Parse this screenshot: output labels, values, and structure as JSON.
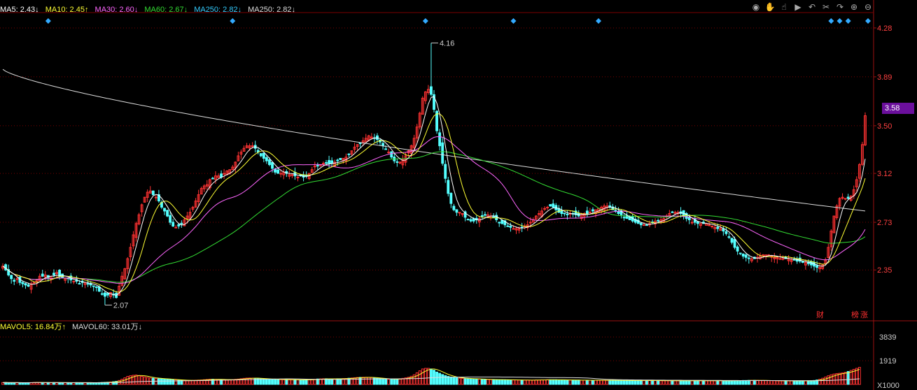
{
  "legend_price": [
    {
      "label": "MA5: ",
      "value": "2.43",
      "arrow": "↓",
      "color": "#ffffff"
    },
    {
      "label": "MA10: ",
      "value": "2.45",
      "arrow": "↑",
      "color": "#ffff33"
    },
    {
      "label": "MA30: ",
      "value": "2.60",
      "arrow": "↓",
      "color": "#ff66ff"
    },
    {
      "label": "MA60: ",
      "value": "2.67",
      "arrow": "↓",
      "color": "#33dd33"
    },
    {
      "label": "MA250: ",
      "value": "2.82",
      "arrow": "↓",
      "color": "#33ccff"
    },
    {
      "label": "MA250: ",
      "value": "2.82",
      "arrow": "↓",
      "color": "#dddddd"
    }
  ],
  "legend_volume": [
    {
      "label": "MAVOL5: ",
      "value": "16.84万",
      "arrow": "↑",
      "color": "#ffff33"
    },
    {
      "label": "MAVOL60: ",
      "value": "33.01万",
      "arrow": "↓",
      "color": "#dddddd"
    }
  ],
  "toolbar_icons": [
    "eye-icon",
    "hand-icon",
    "hand-pointer-icon",
    "play-icon",
    "undo-icon",
    "scissors-icon",
    "redo-icon",
    "zoom-in-icon",
    "zoom-out-icon"
  ],
  "toolbar_glyphs": [
    "◉",
    "✋",
    "☝",
    "▶",
    "↶",
    "✂",
    "↷",
    "⊕",
    "⊖"
  ],
  "last_price": "3.58",
  "tags": {
    "finance": "财",
    "rank": "榜",
    "rise": "涨"
  },
  "colors": {
    "up": "#ff3232",
    "down": "#54ffff",
    "grid": "#7a0000",
    "axis": "#9c1010",
    "axis_text": "#ff4040"
  },
  "chart_data": {
    "type": "candlestick",
    "price_axis": {
      "ylim": [
        1.95,
        4.38
      ],
      "ticks": [
        4.28,
        3.89,
        3.5,
        3.12,
        2.73,
        2.35
      ]
    },
    "volume_axis": {
      "ylim": [
        0,
        4300
      ],
      "ticks": [
        3839,
        1919
      ],
      "unit_label": "X1000"
    },
    "annotations": [
      {
        "text": "4.16",
        "value": 4.16,
        "index": 151
      },
      {
        "text": "2.07",
        "value": 2.07,
        "index": 36
      }
    ],
    "markers": [
      16,
      81,
      149,
      180,
      210,
      292,
      295,
      298,
      305
    ],
    "closes": [
      2.38,
      2.35,
      2.31,
      2.28,
      2.26,
      2.28,
      2.25,
      2.24,
      2.23,
      2.22,
      2.24,
      2.25,
      2.27,
      2.3,
      2.3,
      2.31,
      2.29,
      2.3,
      2.31,
      2.33,
      2.3,
      2.29,
      2.28,
      2.28,
      2.27,
      2.26,
      2.26,
      2.24,
      2.25,
      2.25,
      2.24,
      2.23,
      2.22,
      2.21,
      2.18,
      2.16,
      2.14,
      2.15,
      2.17,
      2.15,
      2.13,
      2.22,
      2.3,
      2.36,
      2.44,
      2.53,
      2.63,
      2.72,
      2.79,
      2.87,
      2.93,
      2.97,
      2.98,
      2.95,
      2.93,
      2.9,
      2.85,
      2.82,
      2.78,
      2.73,
      2.7,
      2.69,
      2.7,
      2.72,
      2.75,
      2.78,
      2.81,
      2.85,
      2.9,
      2.95,
      3,
      3.02,
      3.03,
      3.07,
      3.08,
      3.1,
      3.1,
      3.09,
      3.12,
      3.14,
      3.15,
      3.17,
      3.21,
      3.26,
      3.29,
      3.32,
      3.34,
      3.34,
      3.34,
      3.32,
      3.29,
      3.26,
      3.24,
      3.22,
      3.19,
      3.16,
      3.13,
      3.12,
      3.12,
      3.13,
      3.12,
      3.11,
      3.11,
      3.1,
      3.09,
      3.1,
      3.09,
      3.1,
      3.12,
      3.15,
      3.18,
      3.18,
      3.19,
      3.2,
      3.2,
      3.2,
      3.2,
      3.21,
      3.22,
      3.23,
      3.24,
      3.25,
      3.27,
      3.3,
      3.33,
      3.35,
      3.36,
      3.38,
      3.4,
      3.42,
      3.41,
      3.4,
      3.39,
      3.37,
      3.34,
      3.31,
      3.29,
      3.25,
      3.22,
      3.21,
      3.21,
      3.23,
      3.26,
      3.3,
      3.34,
      3.4,
      3.49,
      3.6,
      3.72,
      3.77,
      3.79,
      3.75,
      3.63,
      3.46,
      3.34,
      3.2,
      3.08,
      2.96,
      2.88,
      2.83,
      2.81,
      2.81,
      2.8,
      2.77,
      2.75,
      2.74,
      2.74,
      2.75,
      2.76,
      2.78,
      2.79,
      2.79,
      2.78,
      2.77,
      2.75,
      2.73,
      2.72,
      2.71,
      2.7,
      2.69,
      2.68,
      2.68,
      2.68,
      2.69,
      2.7,
      2.71,
      2.73,
      2.75,
      2.78,
      2.8,
      2.82,
      2.84,
      2.85,
      2.86,
      2.85,
      2.83,
      2.81,
      2.8,
      2.8,
      2.79,
      2.8,
      2.8,
      2.79,
      2.78,
      2.79,
      2.8,
      2.8,
      2.81,
      2.82,
      2.83,
      2.84,
      2.85,
      2.86,
      2.86,
      2.85,
      2.83,
      2.82,
      2.8,
      2.79,
      2.77,
      2.76,
      2.75,
      2.74,
      2.73,
      2.72,
      2.71,
      2.71,
      2.71,
      2.72,
      2.73,
      2.74,
      2.74,
      2.75,
      2.76,
      2.78,
      2.8,
      2.81,
      2.81,
      2.81,
      2.8,
      2.78,
      2.76,
      2.75,
      2.73,
      2.73,
      2.72,
      2.72,
      2.72,
      2.72,
      2.71,
      2.7,
      2.69,
      2.68,
      2.68,
      2.66,
      2.64,
      2.61,
      2.57,
      2.53,
      2.5,
      2.48,
      2.46,
      2.45,
      2.44,
      2.44,
      2.44,
      2.45,
      2.46,
      2.47,
      2.47,
      2.47,
      2.46,
      2.45,
      2.45,
      2.44,
      2.44,
      2.44,
      2.44,
      2.43,
      2.43,
      2.42,
      2.42,
      2.41,
      2.41,
      2.4,
      2.39,
      2.38,
      2.37,
      2.37,
      2.39,
      2.43,
      2.53,
      2.66,
      2.78,
      2.86,
      2.92,
      2.93,
      2.92,
      2.92,
      2.94,
      2.99,
      3.07,
      3.19,
      3.35,
      3.58
    ],
    "volumes": [
      150,
      160,
      145,
      140,
      138,
      150,
      135,
      130,
      140,
      145,
      150,
      160,
      170,
      165,
      150,
      140,
      145,
      150,
      155,
      160,
      150,
      145,
      140,
      135,
      130,
      140,
      150,
      145,
      140,
      135,
      130,
      125,
      130,
      140,
      150,
      160,
      170,
      180,
      200,
      220,
      250,
      320,
      420,
      530,
      650,
      700,
      740,
      760,
      720,
      660,
      610,
      560,
      520,
      500,
      480,
      470,
      460,
      440,
      420,
      400,
      380,
      360,
      350,
      340,
      330,
      320,
      320,
      330,
      340,
      350,
      360,
      380,
      400,
      420,
      420,
      410,
      400,
      390,
      380,
      380,
      380,
      390,
      410,
      430,
      460,
      490,
      510,
      520,
      510,
      500,
      490,
      470,
      450,
      440,
      430,
      420,
      410,
      400,
      390,
      380,
      380,
      380,
      380,
      380,
      370,
      370,
      370,
      370,
      380,
      400,
      420,
      440,
      450,
      460,
      460,
      450,
      450,
      450,
      460,
      460,
      470,
      480,
      500,
      520,
      540,
      560,
      570,
      580,
      580,
      570,
      550,
      520,
      500,
      480,
      460,
      440,
      420,
      420,
      430,
      440,
      460,
      490,
      530,
      580,
      660,
      780,
      940,
      1100,
      1250,
      1300,
      1300,
      1250,
      1150,
      1000,
      900,
      800,
      720,
      650,
      600,
      560,
      530,
      500,
      490,
      480,
      470,
      460,
      450,
      440,
      430,
      420,
      410,
      400,
      400,
      390,
      390,
      380,
      380,
      380,
      370,
      370,
      360,
      360,
      350,
      350,
      350,
      350,
      350,
      350,
      360,
      360,
      370,
      370,
      380,
      380,
      380,
      380,
      370,
      370,
      360,
      360,
      350,
      350,
      350,
      350,
      340,
      340,
      340,
      340,
      340,
      340,
      330,
      330,
      330,
      330,
      330,
      330,
      330,
      330,
      320,
      320,
      320,
      320,
      320,
      320,
      320,
      320,
      310,
      310,
      310,
      310,
      310,
      310,
      300,
      300,
      300,
      300,
      300,
      300,
      300,
      300,
      300,
      300,
      300,
      300,
      300,
      300,
      300,
      300,
      300,
      300,
      300,
      300,
      300,
      300,
      300,
      300,
      300,
      300,
      310,
      310,
      310,
      320,
      320,
      330,
      330,
      330,
      330,
      320,
      320,
      310,
      310,
      300,
      300,
      290,
      290,
      290,
      290,
      290,
      290,
      290,
      290,
      290,
      290,
      290,
      290,
      300,
      320,
      360,
      420,
      500,
      600,
      700,
      780,
      840,
      880,
      900,
      930,
      980,
      1050,
      1130,
      1220,
      1300,
      1380
    ]
  }
}
